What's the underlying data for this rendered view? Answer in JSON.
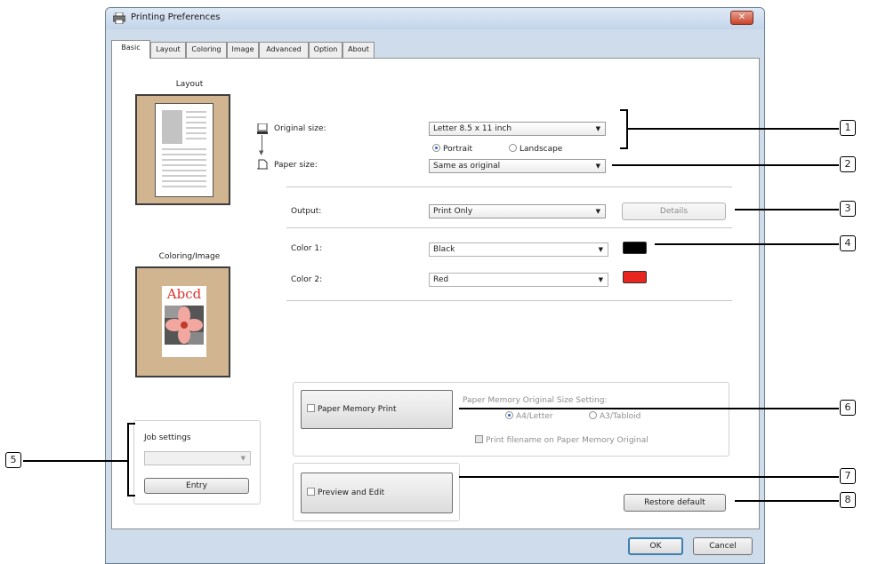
{
  "window": {
    "title": "Printing Preferences",
    "close": "✕"
  },
  "tabs": [
    "Basic",
    "Layout",
    "Coloring",
    "Image",
    "Advanced",
    "Option",
    "About"
  ],
  "preview": {
    "layout_label": "Layout",
    "coloring_label": "Coloring/Image",
    "sample_text": "Abcd"
  },
  "fields": {
    "original_size_label": "Original size:",
    "original_size_value": "Letter 8.5 x 11 inch",
    "portrait": "Portrait",
    "landscape": "Landscape",
    "paper_size_label": "Paper size:",
    "paper_size_value": "Same as original",
    "output_label": "Output:",
    "output_value": "Print Only",
    "details": "Details",
    "color1_label": "Color 1:",
    "color1_value": "Black",
    "color2_label": "Color 2:",
    "color2_value": "Red",
    "swatch1": "#000000",
    "swatch2": "#e8261f"
  },
  "job": {
    "label": "Job settings",
    "entry": "Entry"
  },
  "paper_memory": {
    "checkbox": "Paper Memory Print",
    "setting_label": "Paper Memory Original Size Setting:",
    "a4": "A4/Letter",
    "a3": "A3/Tabloid",
    "filename": "Print filename on Paper Memory Original"
  },
  "preview_edit": "Preview and Edit",
  "restore": "Restore default",
  "ok": "OK",
  "cancel": "Cancel",
  "callouts": [
    "1",
    "2",
    "3",
    "4",
    "5",
    "6",
    "7",
    "8"
  ]
}
